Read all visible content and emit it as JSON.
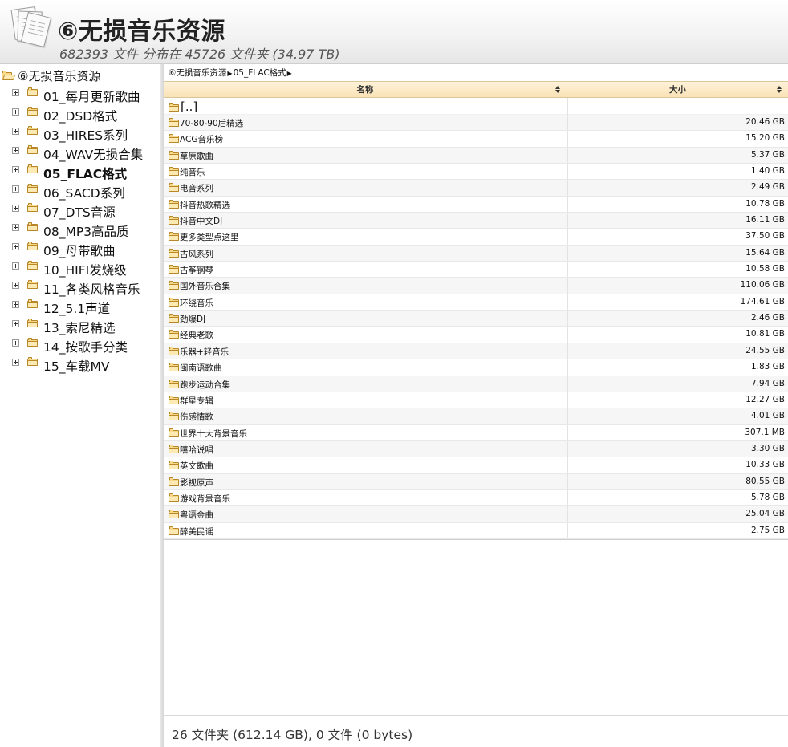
{
  "header": {
    "title": "⑥无损音乐资源",
    "subtitle": "682393 文件 分布在 45726 文件夹 (34.97 TB)"
  },
  "sidebar": {
    "root_label": "⑥无损音乐资源",
    "items": [
      {
        "label": "01_每月更新歌曲",
        "selected": false
      },
      {
        "label": "02_DSD格式",
        "selected": false
      },
      {
        "label": "03_HIRES系列",
        "selected": false
      },
      {
        "label": "04_WAV无损合集",
        "selected": false
      },
      {
        "label": "05_FLAC格式",
        "selected": true
      },
      {
        "label": "06_SACD系列",
        "selected": false
      },
      {
        "label": "07_DTS音源",
        "selected": false
      },
      {
        "label": "08_MP3高品质",
        "selected": false
      },
      {
        "label": "09_母带歌曲",
        "selected": false
      },
      {
        "label": "10_HIFI发烧级",
        "selected": false
      },
      {
        "label": "11_各类风格音乐",
        "selected": false
      },
      {
        "label": "12_5.1声道",
        "selected": false
      },
      {
        "label": "13_索尼精选",
        "selected": false
      },
      {
        "label": "14_按歌手分类",
        "selected": false
      },
      {
        "label": "15_车载MV",
        "selected": false
      }
    ]
  },
  "breadcrumb": {
    "root": "⑥无损音乐资源",
    "current": "05_FLAC格式"
  },
  "table": {
    "columns": {
      "name": "名称",
      "size": "大小"
    },
    "parent_label": "[..]",
    "rows": [
      {
        "name": "70-80-90后精选",
        "size": "20.46 GB"
      },
      {
        "name": "ACG音乐榜",
        "size": "15.20 GB"
      },
      {
        "name": "草原歌曲",
        "size": "5.37 GB"
      },
      {
        "name": "纯音乐",
        "size": "1.40 GB"
      },
      {
        "name": "电音系列",
        "size": "2.49 GB"
      },
      {
        "name": "抖音热歌精选",
        "size": "10.78 GB"
      },
      {
        "name": "抖音中文DJ",
        "size": "16.11 GB"
      },
      {
        "name": "更多类型点这里",
        "size": "37.50 GB"
      },
      {
        "name": "古风系列",
        "size": "15.64 GB"
      },
      {
        "name": "古筝钢琴",
        "size": "10.58 GB"
      },
      {
        "name": "国外音乐合集",
        "size": "110.06 GB"
      },
      {
        "name": "环绕音乐",
        "size": "174.61 GB"
      },
      {
        "name": "劲爆DJ",
        "size": "2.46 GB"
      },
      {
        "name": "经典老歌",
        "size": "10.81 GB"
      },
      {
        "name": "乐器+轻音乐",
        "size": "24.55 GB"
      },
      {
        "name": "闽南语歌曲",
        "size": "1.83 GB"
      },
      {
        "name": "跑步运动合集",
        "size": "7.94 GB"
      },
      {
        "name": "群星专辑",
        "size": "12.27 GB"
      },
      {
        "name": "伤感情歌",
        "size": "4.01 GB"
      },
      {
        "name": "世界十大背景音乐",
        "size": "307.1 MB"
      },
      {
        "name": "嘻哈说唱",
        "size": "3.30 GB"
      },
      {
        "name": "英文歌曲",
        "size": "10.33 GB"
      },
      {
        "name": "影视原声",
        "size": "80.55 GB"
      },
      {
        "name": "游戏背景音乐",
        "size": "5.78 GB"
      },
      {
        "name": "粤语金曲",
        "size": "25.04 GB"
      },
      {
        "name": "醉美民谣",
        "size": "2.75 GB"
      }
    ]
  },
  "footer": {
    "summary": "26 文件夹 (612.14 GB), 0 文件 (0 bytes)"
  },
  "icons": {
    "header": "documents-icon",
    "folder": "folder-icon",
    "open_folder": "folder-open-icon",
    "expander": "plus-expander-icon",
    "sort": "sort-icon"
  },
  "colors": {
    "header_bg": "#f3f3f3",
    "table_header_bg": "#fbe7c0",
    "folder_fill": "#f7d98a",
    "row_alt": "#f6f6f6"
  }
}
